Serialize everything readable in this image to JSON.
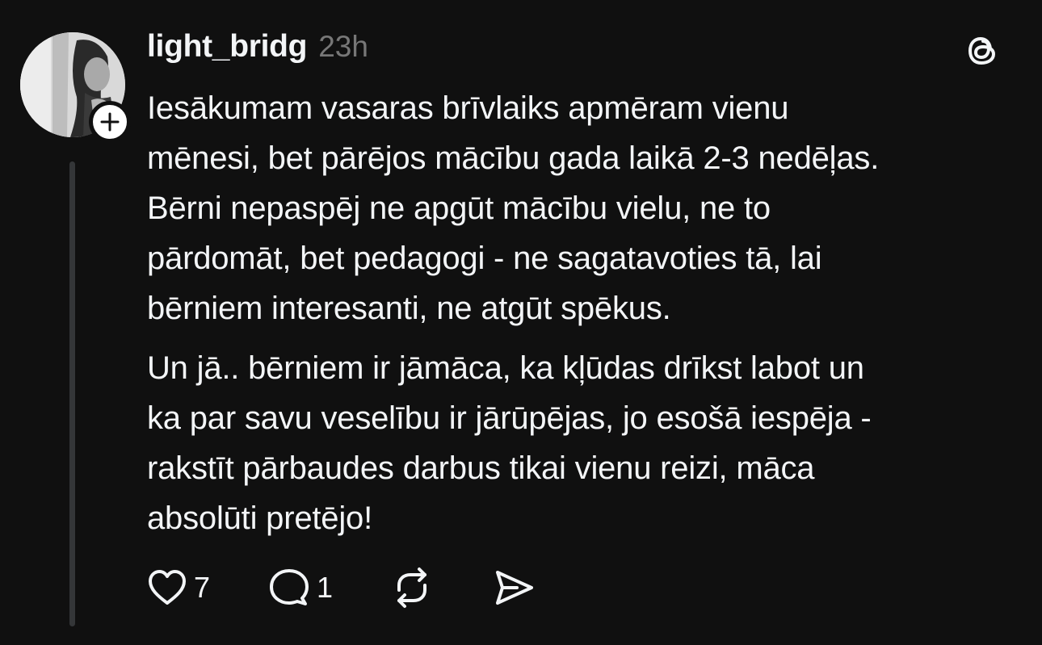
{
  "post": {
    "username": "light_bridg",
    "timestamp": "23h",
    "paragraphs": [
      "Iesākumam vasaras brīvlaiks apmēram vienu\nmēnesi, bet pārējos mācību gada laikā 2-3 nedēļas.\nBērni nepaspēj ne apgūt mācību vielu, ne to\npārdomāt, bet pedagogi - ne sagatavoties tā, lai\nbērniem interesanti, ne atgūt spēkus.",
      "Un jā.. bērniem ir jāmāca, ka kļūdas drīkst labot un\nka par savu veselību ir jārūpējas, jo esošā iespēja -\nrakstīt pārbaudes darbus tikai vienu reizi, māca\nabsolūti pretējo!"
    ],
    "actions": {
      "like_count": "7",
      "reply_count": "1"
    }
  },
  "icons": {
    "like": "heart-icon",
    "reply": "speech-bubble-icon",
    "repost": "repost-arrows-icon",
    "share": "send-arrow-icon",
    "follow": "plus-icon",
    "app_logo": "threads-logo-icon"
  },
  "colors": {
    "background": "#101010",
    "text": "#f3f5f7",
    "muted": "#777777",
    "thread_line": "#343638"
  }
}
